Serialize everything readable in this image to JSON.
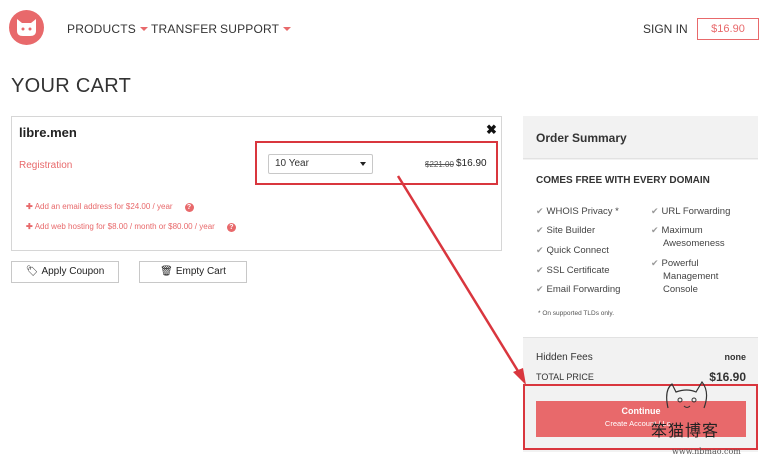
{
  "header": {
    "nav": {
      "products": "PRODUCTS",
      "transfer": "TRANSFER",
      "support": "SUPPORT"
    },
    "sign_in": "SIGN IN",
    "cart_total": "$16.90"
  },
  "page": {
    "title": "YOUR CART"
  },
  "cart": {
    "domain": "libre.men",
    "remove_icon": "✖",
    "registration_label": "Registration",
    "period_selected": "10 Year",
    "old_price": "$221.00",
    "price": "$16.90",
    "addons": [
      {
        "label": "Add an email address for $24.00 / year"
      },
      {
        "label": "Add web hosting for $8.00 / month or $80.00 / year"
      }
    ],
    "apply_coupon": "Apply Coupon",
    "empty_cart": "Empty Cart"
  },
  "summary": {
    "title": "Order Summary",
    "free_title": "COMES FREE WITH EVERY DOMAIN",
    "features_left": [
      "WHOIS Privacy *",
      "Site Builder",
      "Quick Connect",
      "SSL Certificate",
      "Email Forwarding"
    ],
    "features_right": [
      "URL Forwarding",
      "Maximum",
      "Awesomeness",
      "Powerful",
      "Management",
      "Console"
    ],
    "tld_note": "* On supported TLDs only.",
    "hidden_fees_label": "Hidden Fees",
    "hidden_fees_value": "none",
    "total_label": "TOTAL PRICE",
    "total_value": "$16.90",
    "continue_label": "Continue",
    "continue_sub": "Create Account / Lo..."
  },
  "watermark": {
    "text": "笨猫博客",
    "url": "www.nbmao.com"
  },
  "colors": {
    "brand": "#e8696b",
    "annotation": "#d9363e"
  }
}
